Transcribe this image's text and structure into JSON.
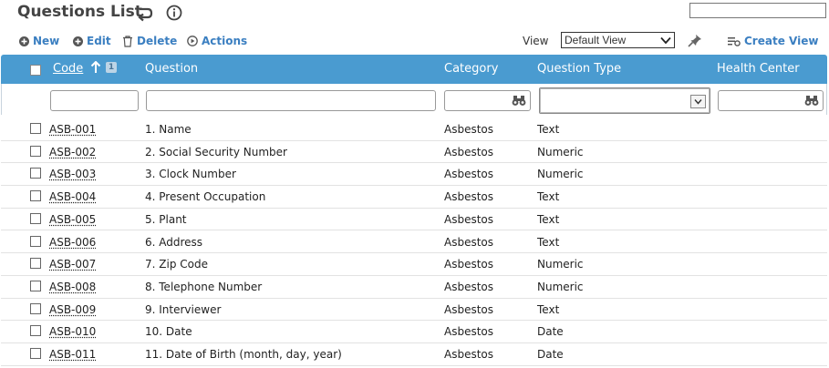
{
  "header": {
    "title": "Questions List",
    "back_icon": "back-arrow-icon",
    "info_icon": "info-icon",
    "search_value": ""
  },
  "toolbar": {
    "new_label": "New",
    "edit_label": "Edit",
    "delete_label": "Delete",
    "actions_label": "Actions",
    "view_label": "View",
    "view_selected": "Default View",
    "create_view_label": "Create View"
  },
  "grid": {
    "columns": {
      "code": "Code",
      "question": "Question",
      "category": "Category",
      "question_type": "Question Type",
      "health_center": "Health Center"
    },
    "sort_order_badge": "1",
    "header_color": "#4a9bd0",
    "link_color": "#3b7fc1",
    "filters": {
      "code": "",
      "question": "",
      "category": "",
      "question_type": "",
      "health_center": ""
    },
    "rows": [
      {
        "code": "ASB-001",
        "question": "1. Name",
        "category": "Asbestos",
        "type": "Text"
      },
      {
        "code": "ASB-002",
        "question": "2. Social Security Number",
        "category": "Asbestos",
        "type": "Numeric"
      },
      {
        "code": "ASB-003",
        "question": "3. Clock Number",
        "category": "Asbestos",
        "type": "Numeric"
      },
      {
        "code": "ASB-004",
        "question": "4. Present Occupation",
        "category": "Asbestos",
        "type": "Text"
      },
      {
        "code": "ASB-005",
        "question": "5. Plant",
        "category": "Asbestos",
        "type": "Text"
      },
      {
        "code": "ASB-006",
        "question": "6. Address",
        "category": "Asbestos",
        "type": "Text"
      },
      {
        "code": "ASB-007",
        "question": "7. Zip Code",
        "category": "Asbestos",
        "type": "Numeric"
      },
      {
        "code": "ASB-008",
        "question": "8. Telephone Number",
        "category": "Asbestos",
        "type": "Numeric"
      },
      {
        "code": "ASB-009",
        "question": "9. Interviewer",
        "category": "Asbestos",
        "type": "Text"
      },
      {
        "code": "ASB-010",
        "question": "10. Date",
        "category": "Asbestos",
        "type": "Date"
      },
      {
        "code": "ASB-011",
        "question": "11. Date of Birth (month, day, year)",
        "category": "Asbestos",
        "type": "Date"
      }
    ]
  }
}
